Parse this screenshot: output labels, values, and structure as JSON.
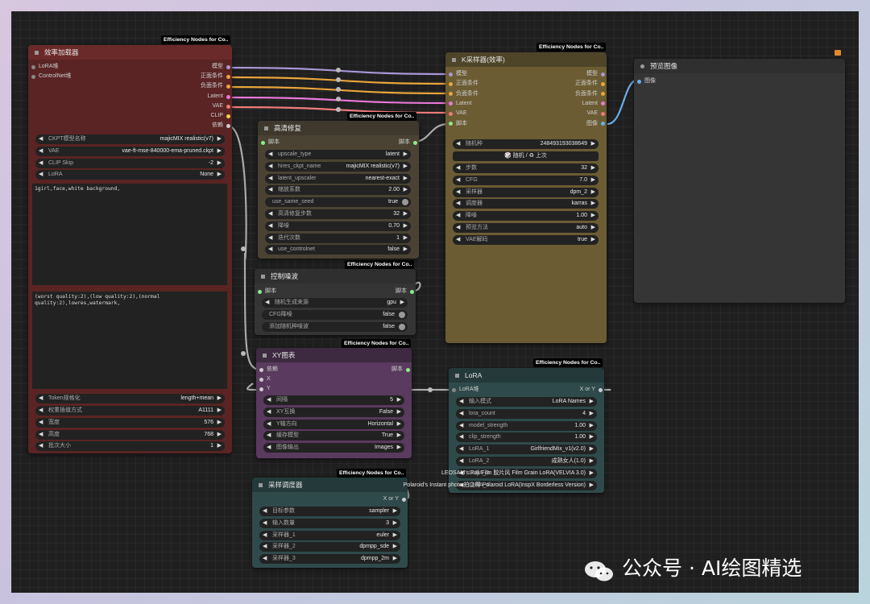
{
  "colors": {
    "loader_header": "#6b2a2a",
    "loader_body": "#5a2424",
    "ksampler_header": "#5e5230",
    "ksampler_body": "#6b5c33",
    "hires_body": "#4a4333",
    "noise_body": "#353535",
    "xy_header": "#3d2a40",
    "xy_body": "#5a3a5e",
    "lora_header": "#234040",
    "lora_body": "#2f4a4a",
    "preview_body": "#353535"
  },
  "loader": {
    "eff_tag": "Efficiency Nodes for Co..",
    "title": "效率加载器",
    "inputs": [
      "LoRA堆",
      "ControlNet堆"
    ],
    "outputs": [
      "模型",
      "正面条件",
      "负面条件",
      "Latent",
      "VAE",
      "CLIP",
      "依赖"
    ],
    "widgets": [
      {
        "label": "CKPT模型名称",
        "value": "majicMIX realistic(v7)"
      },
      {
        "label": "VAE",
        "value": "vae-ft-mse-840000-ema-pruned.ckpt"
      },
      {
        "label": "CLIP Skip",
        "value": "-2"
      },
      {
        "label": "LoRA",
        "value": "None"
      }
    ],
    "positive_text": "1girl,face,white background,",
    "negative_text": "(worst quality:2),(low quality:2),(normal quality:2),lowres,watermark,",
    "widgets2": [
      {
        "label": "Token规格化",
        "value": "length+mean"
      },
      {
        "label": "权重插值方式",
        "value": "A1111"
      },
      {
        "label": "宽度",
        "value": "576"
      },
      {
        "label": "高度",
        "value": "768"
      },
      {
        "label": "批次大小",
        "value": "1"
      }
    ]
  },
  "hires": {
    "eff_tag": "Efficiency Nodes for Co..",
    "title": "高清修复",
    "in": "脚本",
    "out": "脚本",
    "widgets": [
      {
        "label": "upscale_type",
        "value": "latent"
      },
      {
        "label": "hires_ckpt_name",
        "value": "majicMIX realistic(v7)"
      },
      {
        "label": "latent_upscaler",
        "value": "nearest-exact"
      },
      {
        "label": "缩放系数",
        "value": "2.00"
      },
      {
        "label": "use_same_seed",
        "value": "true",
        "toggle": true
      },
      {
        "label": "高清修复步数",
        "value": "32"
      },
      {
        "label": "降噪",
        "value": "0.70"
      },
      {
        "label": "迭代次数",
        "value": "1"
      },
      {
        "label": "use_controlnet",
        "value": "false"
      }
    ]
  },
  "noise": {
    "eff_tag": "Efficiency Nodes for Co..",
    "title": "控制噪波",
    "in": "脚本",
    "out": "脚本",
    "widgets": [
      {
        "label": "随机生成来源",
        "value": "gpu"
      },
      {
        "label": "CFG降噪",
        "value": "false",
        "toggle": true
      },
      {
        "label": "添加随机种噪波",
        "value": "false",
        "toggle": true
      }
    ]
  },
  "xy": {
    "eff_tag": "Efficiency Nodes for Co..",
    "title": "XY图表",
    "inputs": [
      "依赖",
      "X",
      "Y"
    ],
    "out": "脚本",
    "widgets": [
      {
        "label": "间隔",
        "value": "5"
      },
      {
        "label": "XY互换",
        "value": "False"
      },
      {
        "label": "Y轴方向",
        "value": "Horizontal"
      },
      {
        "label": "缓存模型",
        "value": "True"
      },
      {
        "label": "图像输出",
        "value": "Images"
      }
    ]
  },
  "sampler_sched": {
    "eff_tag": "Efficiency Nodes for Co..",
    "title": "采样调度器",
    "out": "X or Y",
    "widgets": [
      {
        "label": "目标参数",
        "value": "sampler"
      },
      {
        "label": "输入数量",
        "value": "3"
      },
      {
        "label": "采样器_1",
        "value": "euler"
      },
      {
        "label": "采样器_2",
        "value": "dpmpp_sde"
      },
      {
        "label": "采样器_3",
        "value": "dpmpp_2m"
      }
    ]
  },
  "ksampler": {
    "eff_tag": "Efficiency Nodes for Co..",
    "title": "K采样器(效率)",
    "inputs": [
      "模型",
      "正面条件",
      "负面条件",
      "Latent",
      "VAE",
      "脚本"
    ],
    "outputs": [
      "模型",
      "正面条件",
      "负面条件",
      "Latent",
      "VAE",
      "图像"
    ],
    "seed": {
      "label": "随机种",
      "value": "248493193038649"
    },
    "seed_button": "🎲 随机 / ♻ 上次",
    "widgets": [
      {
        "label": "步数",
        "value": "32"
      },
      {
        "label": "CFG",
        "value": "7.0"
      },
      {
        "label": "采样器",
        "value": "dpm_2"
      },
      {
        "label": "调度器",
        "value": "karras"
      },
      {
        "label": "降噪",
        "value": "1.00"
      },
      {
        "label": "预览方法",
        "value": "auto"
      },
      {
        "label": "VAE解码",
        "value": "true"
      }
    ]
  },
  "lora": {
    "eff_tag": "Efficiency Nodes for Co..",
    "title": "LoRA",
    "in": "LoRA堆",
    "out": "X or Y",
    "widgets": [
      {
        "label": "输入模式",
        "value": "LoRA Names"
      },
      {
        "label": "lora_count",
        "value": "4"
      },
      {
        "label": "model_strength",
        "value": "1.00"
      },
      {
        "label": "clip_strength",
        "value": "1.00"
      },
      {
        "label": "LoRA_1",
        "value": "GirlfriendMix_v1(v2.0)"
      },
      {
        "label": "LoRA_2",
        "value": "成熟女人(1.0)"
      },
      {
        "label": "LoRA_3",
        "value": "LEOSAM's Fuji Film 胶片风 Film Grain LoRA(VELVIA 3.0)"
      },
      {
        "label": "LoRA_4",
        "value": "Polaroid's Instant photo 拍立得 Polaroid LoRA(InspX Borderless Version)"
      }
    ]
  },
  "preview": {
    "title": "预览图像",
    "input": "图像"
  },
  "watermark": "公众号 · AI绘图精选"
}
